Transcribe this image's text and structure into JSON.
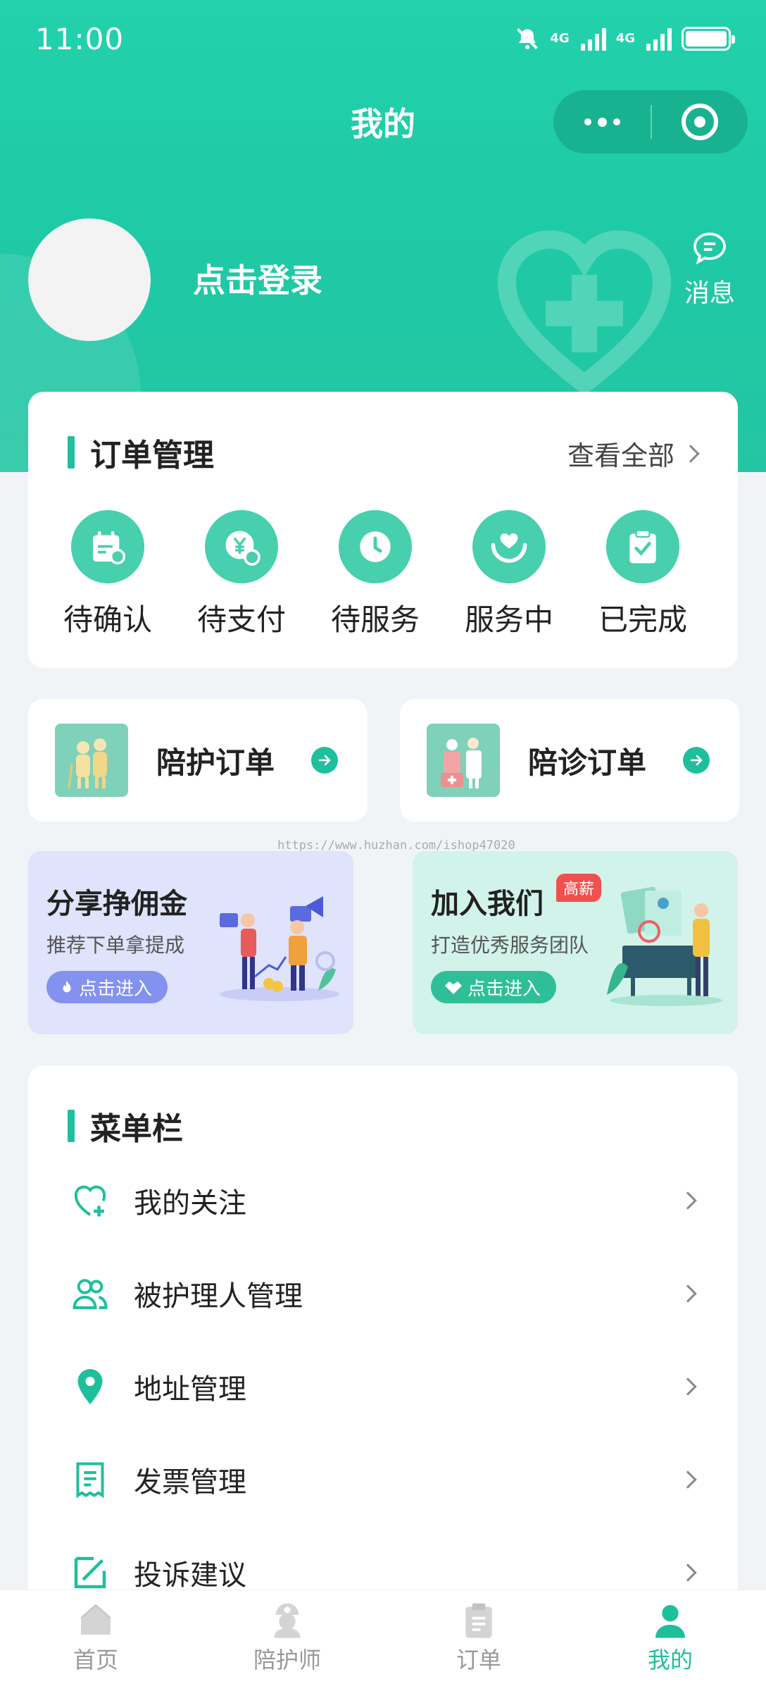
{
  "status_bar": {
    "time": "11:00",
    "network1": "4G",
    "network2": "4G"
  },
  "header": {
    "title": "我的"
  },
  "profile": {
    "login_text": "点击登录",
    "message_label": "消息"
  },
  "orders": {
    "title": "订单管理",
    "view_all": "查看全部",
    "statuses": [
      {
        "label": "待确认",
        "icon": "calendar-icon"
      },
      {
        "label": "待支付",
        "icon": "yen-clock-icon"
      },
      {
        "label": "待服务",
        "icon": "clock-icon"
      },
      {
        "label": "服务中",
        "icon": "heart-hand-icon"
      },
      {
        "label": "已完成",
        "icon": "clipboard-check-icon"
      }
    ]
  },
  "quick_orders": [
    {
      "label": "陪护订单"
    },
    {
      "label": "陪诊订单"
    }
  ],
  "watermark": "https://www.huzhan.com/ishop47020",
  "promos": [
    {
      "title": "分享挣佣金",
      "subtitle": "推荐下单拿提成",
      "button": "点击进入",
      "bg": "#dfe3fb",
      "btn_color": "#8392ef"
    },
    {
      "title": "加入我们",
      "tag": "高薪",
      "subtitle": "打造优秀服务团队",
      "button": "点击进入",
      "bg": "#d2f3ea",
      "btn_color": "#2fbf98"
    }
  ],
  "menu": {
    "title": "菜单栏",
    "items": [
      {
        "label": "我的关注",
        "icon": "heart-plus-icon"
      },
      {
        "label": "被护理人管理",
        "icon": "users-icon"
      },
      {
        "label": "地址管理",
        "icon": "location-pin-icon"
      },
      {
        "label": "发票管理",
        "icon": "invoice-icon"
      },
      {
        "label": "投诉建议",
        "icon": "edit-icon"
      }
    ]
  },
  "tabbar": {
    "items": [
      {
        "label": "首页",
        "icon": "home-icon",
        "active": false
      },
      {
        "label": "陪护师",
        "icon": "nurse-icon",
        "active": false
      },
      {
        "label": "订单",
        "icon": "clipboard-icon",
        "active": false
      },
      {
        "label": "我的",
        "icon": "user-icon",
        "active": true
      }
    ]
  },
  "colors": {
    "accent": "#1fbf9c",
    "header": "#22d2ad"
  }
}
